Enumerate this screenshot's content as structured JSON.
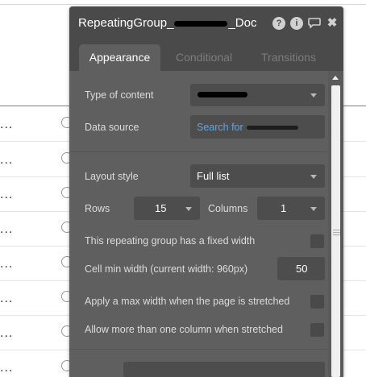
{
  "panel": {
    "title_prefix": "RepeatingGroup_",
    "title_suffix": "_Doc",
    "header_icons": [
      "help-icon",
      "info-icon",
      "comment-icon",
      "close-icon"
    ],
    "help_glyph": "?",
    "info_glyph": "i",
    "comment_glyph": "⌖",
    "close_glyph": "✖"
  },
  "tabs": [
    {
      "label": "Appearance",
      "active": true
    },
    {
      "label": "Conditional",
      "active": false
    },
    {
      "label": "Transitions",
      "active": false
    }
  ],
  "form": {
    "type_of_content_label": "Type of content",
    "data_source_label": "Data source",
    "data_source_value_prefix": "Search for ",
    "layout_style_label": "Layout style",
    "layout_style_value": "Full list",
    "rows_label": "Rows",
    "rows_value": "15",
    "columns_label": "Columns",
    "columns_value": "1",
    "fixed_width_label": "This repeating group has a fixed width",
    "cell_min_width_label": "Cell min width (current width: 960px)",
    "cell_min_width_value": "50",
    "max_width_label": "Apply a max width when the page is stretched",
    "multi_column_label": "Allow more than one column when stretched"
  },
  "background": {
    "row_ellipsis": "..."
  },
  "colors": {
    "panel_bg": "#5f5f5f",
    "header_bg": "#4a4a4a",
    "link_blue": "#5aa6e6",
    "bg_accent_line": "#4a90b8"
  }
}
